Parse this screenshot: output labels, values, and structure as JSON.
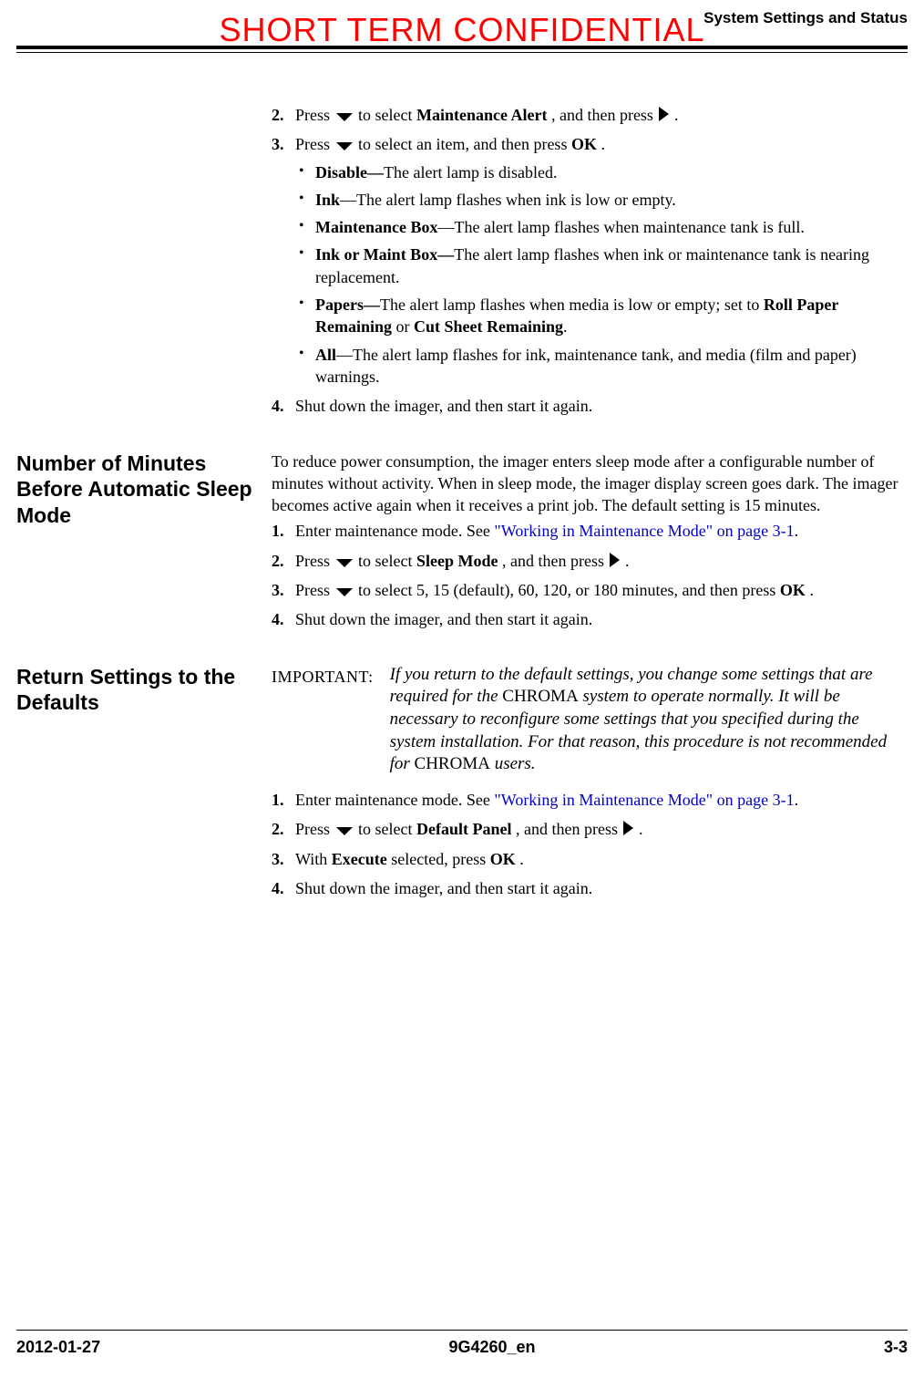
{
  "header": {
    "stamp": "SHORT TERM CONFIDENTIAL",
    "running_head": "System Settings and Status"
  },
  "section1": {
    "steps": {
      "s2": {
        "num": "2.",
        "t1": "Press ",
        "t2": " to select ",
        "bold1": "Maintenance Alert",
        "t3": ", and then press ",
        "t4": "."
      },
      "s3": {
        "num": "3.",
        "t1": "Press ",
        "t2": " to select an item, and then press ",
        "bold1": "OK",
        "t3": "."
      },
      "s4": {
        "num": "4.",
        "t1": "Shut down the imager, and then start it again."
      }
    },
    "bullets": {
      "b1": {
        "bold": "Disable—",
        "rest": "The alert lamp is disabled."
      },
      "b2": {
        "bold": "Ink",
        "rest": "—The alert lamp flashes when ink is low or empty."
      },
      "b3": {
        "bold": "Maintenance Box",
        "rest": "—The alert lamp flashes when maintenance tank is full."
      },
      "b4": {
        "bold": "Ink or Maint Box—",
        "rest": "The alert lamp flashes when ink or maintenance tank is nearing replacement."
      },
      "b5": {
        "bold": "Papers—",
        "rest1": "The alert lamp flashes when media is low or empty; set to ",
        "bold2": "Roll Paper Remaining",
        "rest2": " or ",
        "bold3": "Cut Sheet Remaining",
        "rest3": "."
      },
      "b6": {
        "bold": "All",
        "rest": "—The alert lamp flashes for ink, maintenance tank, and media (film and paper) warnings."
      }
    }
  },
  "section2": {
    "heading": "Number of Minutes Before Automatic Sleep Mode",
    "intro": "To reduce power consumption, the imager enters sleep mode after a configurable number of minutes without activity. When in sleep mode, the imager display screen goes dark. The imager becomes active again when it receives a print job. The default setting is 15 minutes.",
    "steps": {
      "s1": {
        "num": "1.",
        "t1": "Enter maintenance mode. See ",
        "link": "\"Working in Maintenance Mode\" on page 3-1",
        "t2": "."
      },
      "s2": {
        "num": "2.",
        "t1": "Press ",
        "t2": " to select ",
        "bold1": "Sleep Mode",
        "t3": ", and then press ",
        "t4": "."
      },
      "s3": {
        "num": "3.",
        "t1": "Press ",
        "t2": " to select 5, 15 (default), 60, 120, or 180 minutes, and then press ",
        "bold1": "OK",
        "t3": "."
      },
      "s4": {
        "num": "4.",
        "t1": "Shut down the imager, and then start it again."
      }
    }
  },
  "section3": {
    "heading": "Return Settings to the Defaults",
    "important_label": "IMPORTANT:",
    "important_body_1": "If you return to the default settings, you change some settings that are required for the ",
    "important_sc1": "CHROMA",
    "important_body_2": " system to operate normally. It will be necessary to reconfigure some settings that you specified during the system installation. For that reason, this procedure is not recommended for ",
    "important_sc2": "CHROMA",
    "important_body_3": " users.",
    "steps": {
      "s1": {
        "num": "1.",
        "t1": "Enter maintenance mode. See ",
        "link": "\"Working in Maintenance Mode\" on page 3-1",
        "t2": "."
      },
      "s2": {
        "num": "2.",
        "t1": "Press ",
        "t2": " to select ",
        "bold1": "Default Panel",
        "t3": ", and then press ",
        "t4": "."
      },
      "s3": {
        "num": "3.",
        "t1": "With ",
        "bold1": "Execute",
        "t2": " selected, press ",
        "bold2": "OK",
        "t3": "."
      },
      "s4": {
        "num": "4.",
        "t1": "Shut down the imager, and then start it again."
      }
    }
  },
  "footer": {
    "date": "2012-01-27",
    "docid": "9G4260_en",
    "page": "3-3"
  }
}
